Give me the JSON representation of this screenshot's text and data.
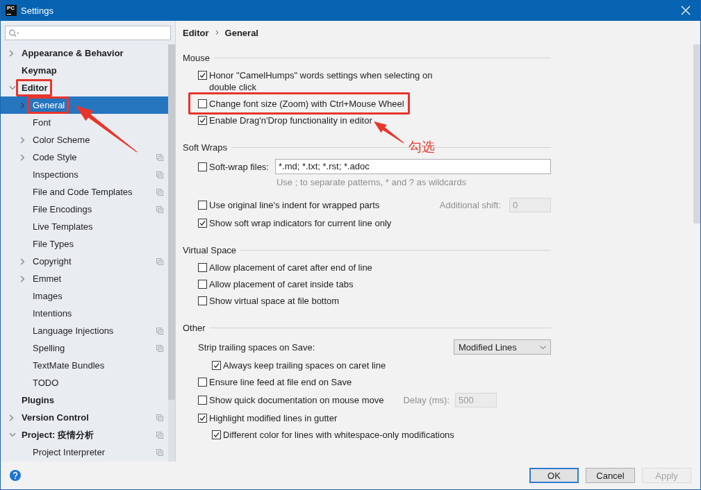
{
  "window": {
    "title": "Settings",
    "logo_text": "PC"
  },
  "sidebar": {
    "tree": [
      {
        "label": "Appearance & Behavior",
        "expanded": false,
        "selected": false,
        "project_icon": false,
        "callout": false
      },
      {
        "label": "Keymap",
        "selected": false,
        "project_icon": false,
        "callout": false
      },
      {
        "label": "Editor",
        "expanded": true,
        "selected": false,
        "project_icon": false,
        "callout": true,
        "children": [
          {
            "label": "General",
            "expanded": false,
            "selected": true,
            "project_icon": false,
            "callout": true
          },
          {
            "label": "Font",
            "selected": false,
            "project_icon": false,
            "callout": false
          },
          {
            "label": "Color Scheme",
            "expanded": false,
            "selected": false,
            "project_icon": false,
            "callout": false
          },
          {
            "label": "Code Style",
            "expanded": false,
            "selected": false,
            "project_icon": true,
            "callout": false
          },
          {
            "label": "Inspections",
            "selected": false,
            "project_icon": true,
            "callout": false
          },
          {
            "label": "File and Code Templates",
            "selected": false,
            "project_icon": true,
            "callout": false
          },
          {
            "label": "File Encodings",
            "selected": false,
            "project_icon": true,
            "callout": false
          },
          {
            "label": "Live Templates",
            "selected": false,
            "project_icon": false,
            "callout": false
          },
          {
            "label": "File Types",
            "selected": false,
            "project_icon": false,
            "callout": false
          },
          {
            "label": "Copyright",
            "expanded": false,
            "selected": false,
            "project_icon": true,
            "callout": false
          },
          {
            "label": "Emmet",
            "expanded": false,
            "selected": false,
            "project_icon": false,
            "callout": false
          },
          {
            "label": "Images",
            "selected": false,
            "project_icon": false,
            "callout": false
          },
          {
            "label": "Intentions",
            "selected": false,
            "project_icon": false,
            "callout": false
          },
          {
            "label": "Language Injections",
            "selected": false,
            "project_icon": true,
            "callout": false
          },
          {
            "label": "Spelling",
            "selected": false,
            "project_icon": true,
            "callout": false
          },
          {
            "label": "TextMate Bundles",
            "selected": false,
            "project_icon": false,
            "callout": false
          },
          {
            "label": "TODO",
            "selected": false,
            "project_icon": false,
            "callout": false
          }
        ]
      },
      {
        "label": "Plugins",
        "selected": false,
        "project_icon": false,
        "callout": false
      },
      {
        "label": "Version Control",
        "expanded": false,
        "selected": false,
        "project_icon": true,
        "callout": false
      },
      {
        "label": "Project: 疫情分析",
        "expanded": true,
        "selected": false,
        "project_icon": true,
        "callout": false,
        "children": [
          {
            "label": "Project Interpreter",
            "selected": false,
            "project_icon": true,
            "callout": false
          }
        ]
      }
    ]
  },
  "content": {
    "breadcrumb": [
      "Editor",
      "General"
    ],
    "sections": [
      {
        "title": "Mouse",
        "rows": [
          {
            "kind": "checkbox",
            "label": "Honor \"CamelHumps\" words settings when selecting on double click",
            "checked": true,
            "callout": false
          },
          {
            "kind": "checkbox",
            "label": "Change font size (Zoom) with Ctrl+Mouse Wheel",
            "checked": false,
            "callout": true
          },
          {
            "kind": "checkbox",
            "label": "Enable Drag'n'Drop functionality in editor",
            "checked": true,
            "callout": false
          }
        ]
      },
      {
        "title": "Soft Wraps",
        "rows": [
          {
            "kind": "checkbox_field",
            "label": "Soft-wrap files:",
            "checked": false,
            "callout": false,
            "value": "*.md; *.txt; *.rst; *.adoc",
            "hint": "Use ; to separate patterns, * and ? as wildcards"
          },
          {
            "kind": "checkbox_extra",
            "label": "Use original line's indent for wrapped parts",
            "checked": false,
            "callout": false,
            "extra": {
              "label": "Additional shift:",
              "value": "0",
              "disabled": true
            }
          },
          {
            "kind": "checkbox",
            "label": "Show soft wrap indicators for current line only",
            "checked": true,
            "callout": false
          }
        ]
      },
      {
        "title": "Virtual Space",
        "rows": [
          {
            "kind": "checkbox",
            "label": "Allow placement of caret after end of line",
            "checked": false,
            "callout": false
          },
          {
            "kind": "checkbox",
            "label": "Allow placement of caret inside tabs",
            "checked": false,
            "callout": false
          },
          {
            "kind": "checkbox",
            "label": "Show virtual space at file bottom",
            "checked": false,
            "callout": false
          }
        ]
      },
      {
        "title": "Other",
        "rows": [
          {
            "kind": "dropdown",
            "label": "Strip trailing spaces on Save:",
            "value": "Modified Lines",
            "callout": false,
            "children": [
              {
                "kind": "checkbox",
                "label": "Always keep trailing spaces on caret line",
                "checked": true,
                "callout": false
              }
            ]
          },
          {
            "kind": "checkbox",
            "label": "Ensure line feed at file end on Save",
            "checked": false,
            "callout": false
          },
          {
            "kind": "checkbox_extra",
            "label": "Show quick documentation on mouse move",
            "checked": false,
            "callout": false,
            "extra": {
              "label": "Delay (ms):",
              "value": "500",
              "disabled": true
            }
          },
          {
            "kind": "checkbox",
            "label": "Highlight modified lines in gutter",
            "checked": true,
            "callout": false,
            "children": [
              {
                "kind": "checkbox",
                "label": "Different color for lines with whitespace-only modifications",
                "checked": true,
                "callout": false
              }
            ]
          }
        ]
      }
    ]
  },
  "annotations": [
    {
      "kind": "arrow"
    },
    {
      "kind": "arrow",
      "label": "勾选"
    }
  ],
  "buttons": [
    {
      "label": "OK",
      "default": true,
      "disabled": false
    },
    {
      "label": "Cancel",
      "default": false,
      "disabled": false
    },
    {
      "label": "Apply",
      "default": false,
      "disabled": true
    }
  ]
}
